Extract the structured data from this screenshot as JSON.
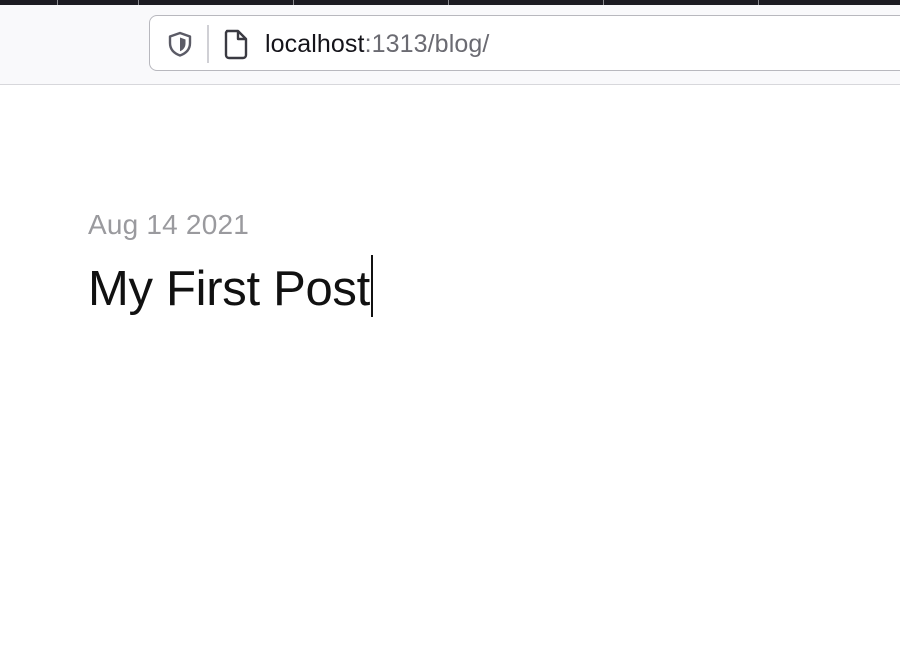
{
  "browser": {
    "address_bar": {
      "host": "localhost",
      "path": ":1313/blog/",
      "shield_icon": "shield-icon",
      "page_icon": "page-icon"
    }
  },
  "post": {
    "date": "Aug 14 2021",
    "title": "My First Post"
  }
}
